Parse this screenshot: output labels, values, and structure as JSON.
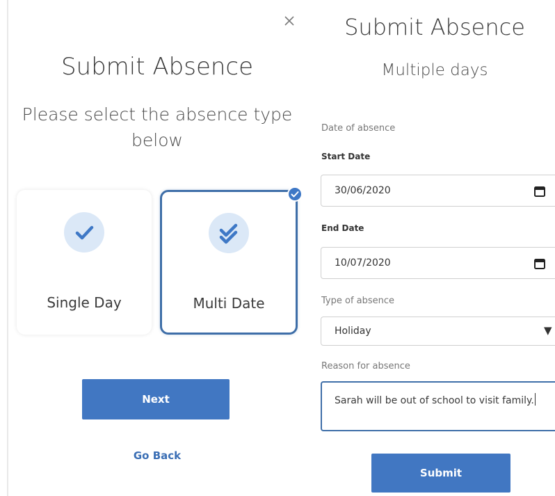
{
  "left": {
    "title": "Submit Absence",
    "subtitle": "Please select the absence type below",
    "cards": [
      {
        "label": "Single Day",
        "icon": "check-icon",
        "selected": false
      },
      {
        "label": "Multi Date",
        "icon": "double-check-icon",
        "selected": true
      }
    ],
    "next_label": "Next",
    "go_back_label": "Go Back",
    "close_icon": "close-icon"
  },
  "right": {
    "title": "Submit Absence",
    "subtitle": "Multiple days",
    "date_section_label": "Date of absence",
    "start_date_label": "Start Date",
    "start_date_value": "30/06/2020",
    "end_date_label": "End Date",
    "end_date_value": "10/07/2020",
    "type_label": "Type of absence",
    "type_value": "Holiday",
    "reason_label": "Reason for absence",
    "reason_value": "Sarah will be out of school to visit family.",
    "submit_label": "Submit"
  },
  "colors": {
    "accent": "#4177c2",
    "selected_border": "#3e6ea8",
    "icon_bg": "#dbe8f7",
    "link": "#3b6fb5"
  }
}
